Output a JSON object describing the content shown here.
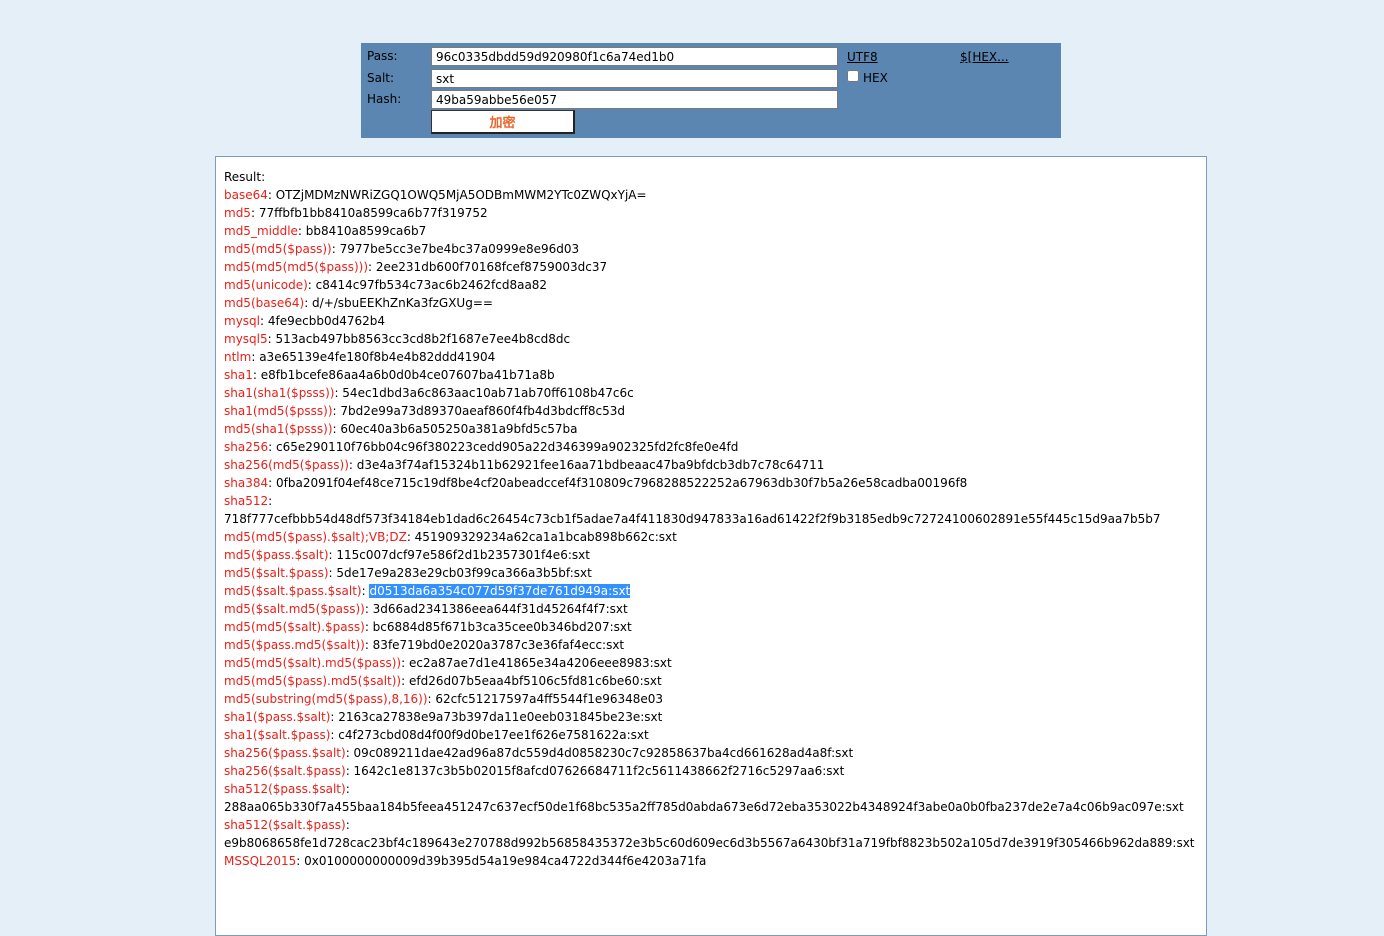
{
  "form": {
    "pass_label": "Pass:",
    "pass_value": "96c0335dbdd59d920980f1c6a74ed1b0",
    "salt_label": "Salt:",
    "salt_value": "sxt",
    "hash_label": "Hash:",
    "hash_value": "49ba59abbe56e057",
    "encrypt_button": "加密",
    "utf8_link": "UTF8",
    "hex_link": "$[HEX...",
    "hex_checkbox_label": "HEX",
    "hex_checked": false
  },
  "colors": {
    "page_bg": "#e4eff8",
    "panel_bg": "#5a86b1",
    "key_color": "#e8201a",
    "button_text": "#e8672a",
    "selection_bg": "#3390ff"
  },
  "result": {
    "heading": "Result:",
    "items": [
      {
        "key": "base64",
        "value": "OTZjMDMzNWRiZGQ1OWQ5MjA5ODBmMWM2YTc0ZWQxYjA="
      },
      {
        "key": "md5",
        "value": "77ffbfb1bb8410a8599ca6b77f319752"
      },
      {
        "key": "md5_middle",
        "value": "bb8410a8599ca6b7"
      },
      {
        "key": "md5(md5($pass))",
        "value": "7977be5cc3e7be4bc37a0999e8e96d03"
      },
      {
        "key": "md5(md5(md5($pass)))",
        "value": "2ee231db600f70168fcef8759003dc37"
      },
      {
        "key": "md5(unicode)",
        "value": "c8414c97fb534c73ac6b2462fcd8aa82"
      },
      {
        "key": "md5(base64)",
        "value": "d/+/sbuEEKhZnKa3fzGXUg=="
      },
      {
        "key": "mysql",
        "value": "4fe9ecbb0d4762b4"
      },
      {
        "key": "mysql5",
        "value": "513acb497bb8563cc3cd8b2f1687e7ee4b8cd8dc"
      },
      {
        "key": "ntlm",
        "value": "a3e65139e4fe180f8b4e4b82ddd41904"
      },
      {
        "key": "sha1",
        "value": "e8fb1bcefe86aa4a6b0d0b4ce07607ba41b71a8b"
      },
      {
        "key": "sha1(sha1($psss))",
        "value": "54ec1dbd3a6c863aac10ab71ab70ff6108b47c6c"
      },
      {
        "key": "sha1(md5($psss))",
        "value": "7bd2e99a73d89370aeaf860f4fb4d3bdcff8c53d"
      },
      {
        "key": "md5(sha1($psss))",
        "value": "60ec40a3b6a505250a381a9bfd5c57ba"
      },
      {
        "key": "sha256",
        "value": "c65e290110f76bb04c96f380223cedd905a22d346399a902325fd2fc8fe0e4fd"
      },
      {
        "key": "sha256(md5($pass))",
        "value": "d3e4a3f74af15324b11b62921fee16aa71bdbeaac47ba9bfdcb3db7c78c64711"
      },
      {
        "key": "sha384",
        "value": "0fba2091f04ef48ce715c19df8be4cf20abeadccef4f310809c7968288522252a67963db30f7b5a26e58cadba00196f8"
      },
      {
        "key": "sha512",
        "value": "718f777cefbbb54d48df573f34184eb1dad6c26454c73cb1f5adae7a4f411830d947833a16ad61422f2f9b3185edb9c72724100602891e55f445c15d9aa7b5b7",
        "wrap": true
      },
      {
        "key": "md5(md5($pass).$salt);VB;DZ",
        "value": "451909329234a62ca1a1bcab898b662c:sxt"
      },
      {
        "key": "md5($pass.$salt)",
        "value": "115c007dcf97e586f2d1b2357301f4e6:sxt"
      },
      {
        "key": "md5($salt.$pass)",
        "value": "5de17e9a283e29cb03f99ca366a3b5bf:sxt"
      },
      {
        "key": "md5($salt.$pass.$salt)",
        "value": "d0513da6a354c077d59f37de761d949a:sxt",
        "selected": true
      },
      {
        "key": "md5($salt.md5($pass))",
        "value": "3d66ad2341386eea644f31d45264f4f7:sxt"
      },
      {
        "key": "md5(md5($salt).$pass)",
        "value": "bc6884d85f671b3ca35cee0b346bd207:sxt"
      },
      {
        "key": "md5($pass.md5($salt))",
        "value": "83fe719bd0e2020a3787c3e36faf4ecc:sxt"
      },
      {
        "key": "md5(md5($salt).md5($pass))",
        "value": "ec2a87ae7d1e41865e34a4206eee8983:sxt"
      },
      {
        "key": "md5(md5($pass).md5($salt))",
        "value": "efd26d07b5eaa4bf5106c5fd81c6be60:sxt"
      },
      {
        "key": "md5(substring(md5($pass),8,16))",
        "value": "62cfc51217597a4ff5544f1e96348e03"
      },
      {
        "key": "sha1($pass.$salt)",
        "value": "2163ca27838e9a73b397da11e0eeb031845be23e:sxt"
      },
      {
        "key": "sha1($salt.$pass)",
        "value": "c4f273cbd08d4f00f9d0be17ee1f626e7581622a:sxt"
      },
      {
        "key": "sha256($pass.$salt)",
        "value": "09c089211dae42ad96a87dc559d4d0858230c7c92858637ba4cd661628ad4a8f:sxt"
      },
      {
        "key": "sha256($salt.$pass)",
        "value": "1642c1e8137c3b5b02015f8afcd07626684711f2c5611438662f2716c5297aa6:sxt"
      },
      {
        "key": "sha512($pass.$salt)",
        "value": "288aa065b330f7a455baa184b5feea451247c637ecf50de1f68bc535a2ff785d0abda673e6d72eba353022b4348924f3abe0a0b0fba237de2e7a4c06b9ac097e:sxt",
        "wrap": true
      },
      {
        "key": "sha512($salt.$pass)",
        "value": "e9b8068658fe1d728cac23bf4c189643e270788d992b56858435372e3b5c60d609ec6d3b5567a6430bf31a719fbf8823b502a105d7de3919f305466b962da889:sxt",
        "wrap": true
      },
      {
        "key": "MSSQL2015",
        "value": "0x0100000000009d39b395d54a19e984ca4722d344f6e4203a71fa"
      }
    ]
  }
}
